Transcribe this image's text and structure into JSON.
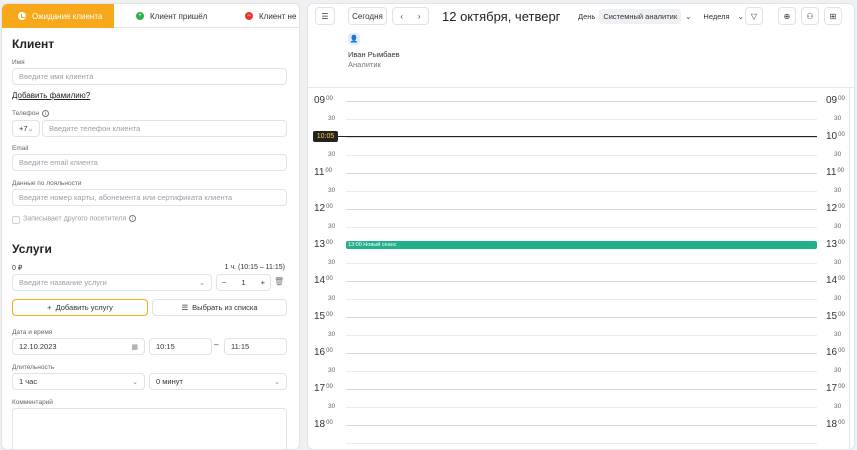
{
  "tabs": [
    {
      "label": "Ожидание клиента"
    },
    {
      "label": "Клиент пришёл"
    },
    {
      "label": "Клиент не пришёл"
    }
  ],
  "client": {
    "title": "Клиент",
    "name_label": "Имя",
    "name_placeholder": "Введите имя клиента",
    "add_surname": "Добавить фамилию?",
    "phone_label": "Телефон",
    "phone_code": "+7",
    "phone_placeholder": "Введите телефон клиента",
    "email_label": "Email",
    "email_placeholder": "Введите email клиента",
    "loyalty_label": "Данные по лояльности",
    "loyalty_placeholder": "Введите номер карты, абонемента или сертификата клиента",
    "another_visitor": "Записывает другого посетителя"
  },
  "services": {
    "title": "Услуги",
    "price": "0 ₽",
    "duration_summary": "1 ч. (10:15 – 11:15)",
    "service_placeholder": "Введите название услуги",
    "quantity": "1",
    "minus": "−",
    "plus": "+",
    "add_button": "Добавить услугу",
    "choose_button": "Выбрать из списка",
    "datetime_label": "Дата и время",
    "date": "12.10.2023",
    "time_from": "10:15",
    "dash": "–",
    "time_to": "11:15",
    "duration_label": "Длительность",
    "hours": "1 час",
    "minutes": "0 минут",
    "comment_label": "Комментарий"
  },
  "calendar": {
    "today_button": "Сегодня",
    "date_title": "12 октября, четверг",
    "view_day": "День",
    "view_analyst": "Системный аналитик",
    "view_week": "Неделя",
    "staff_name": "Иван Рымбаев",
    "staff_role": "Аналитик",
    "now_time": "10:05",
    "event_label": "13:00 Новый сеанс",
    "hours": [
      "09",
      "10",
      "11",
      "12",
      "13",
      "14",
      "15",
      "16",
      "17",
      "18"
    ],
    "minutes_suffix": "00",
    "half_label": "30"
  },
  "colors": {
    "accent": "#f7a81b",
    "came": "#2bb14a",
    "not_came": "#e53935",
    "event": "#22b08a"
  }
}
